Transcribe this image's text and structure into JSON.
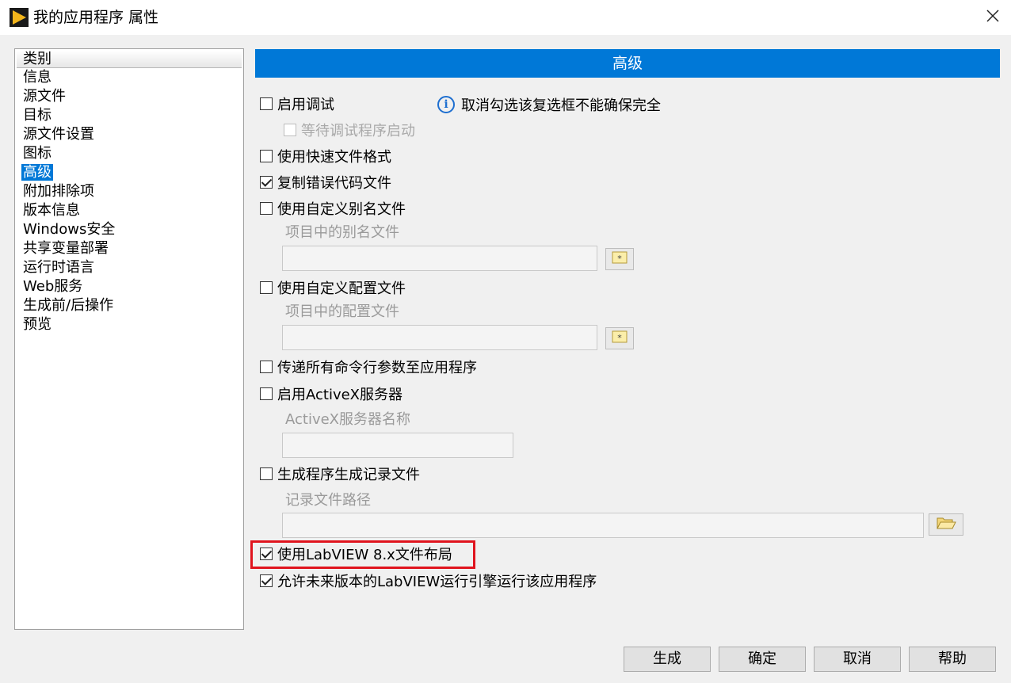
{
  "window": {
    "title": "我的应用程序 属性",
    "app_icon": "labview-run-arrow-icon",
    "close_icon": "close-icon"
  },
  "sidebar": {
    "header": "类别",
    "items": [
      {
        "label": "信息"
      },
      {
        "label": "源文件"
      },
      {
        "label": "目标"
      },
      {
        "label": "源文件设置"
      },
      {
        "label": "图标"
      },
      {
        "label": "高级",
        "selected": true
      },
      {
        "label": "附加排除项"
      },
      {
        "label": "版本信息"
      },
      {
        "label": "Windows安全"
      },
      {
        "label": "共享变量部署"
      },
      {
        "label": "运行时语言"
      },
      {
        "label": "Web服务"
      },
      {
        "label": "生成前/后操作"
      },
      {
        "label": "预览"
      }
    ]
  },
  "main": {
    "section_title": "高级",
    "info_text": "取消勾选该复选框不能确保完全",
    "options": {
      "enable_debug": {
        "label": "启用调试",
        "checked": false
      },
      "wait_debugger": {
        "label": "等待调试程序启动",
        "checked": false,
        "disabled": true
      },
      "fast_file_format": {
        "label": "使用快速文件格式",
        "checked": false
      },
      "copy_error_code": {
        "label": "复制错误代码文件",
        "checked": true
      },
      "custom_alias": {
        "label": "使用自定义别名文件",
        "checked": false
      },
      "custom_config": {
        "label": "使用自定义配置文件",
        "checked": false
      },
      "pass_cmdline": {
        "label": "传递所有命令行参数至应用程序",
        "checked": false
      },
      "activex_server": {
        "label": "启用ActiveX服务器",
        "checked": false
      },
      "build_log": {
        "label": "生成程序生成记录文件",
        "checked": false
      },
      "lv8_layout": {
        "label": "使用LabVIEW 8.x文件布局",
        "checked": true
      },
      "allow_future": {
        "label": "允许未来版本的LabVIEW运行引擎运行该应用程序",
        "checked": true
      }
    },
    "fields": {
      "alias_file": {
        "label": "项目中的别名文件",
        "value": ""
      },
      "config_file": {
        "label": "项目中的配置文件",
        "value": ""
      },
      "activex_name": {
        "label": "ActiveX服务器名称",
        "value": ""
      },
      "log_path": {
        "label": "记录文件路径",
        "value": ""
      }
    }
  },
  "buttons": {
    "build": "生成",
    "ok": "确定",
    "cancel": "取消",
    "help": "帮助"
  },
  "colors": {
    "accent": "#0078d7",
    "highlight_box": "#e0141e"
  }
}
